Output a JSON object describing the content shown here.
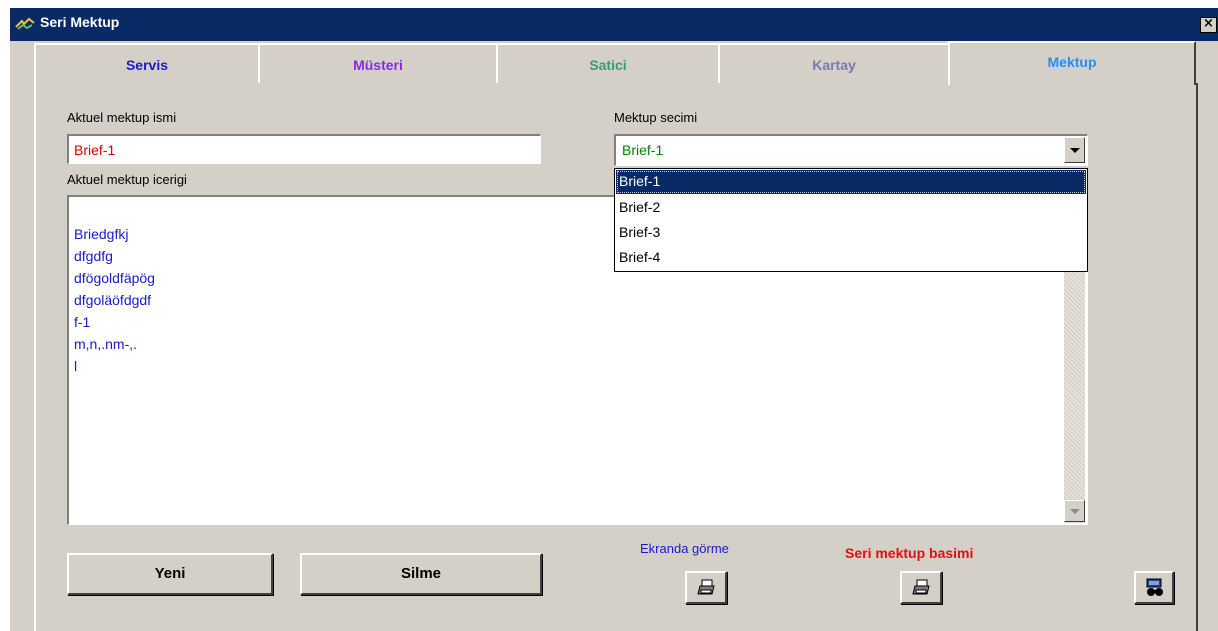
{
  "window": {
    "title": "Seri Mektup",
    "close_label": "×"
  },
  "tabs": [
    {
      "label": "Servis",
      "color": "#1a1acc"
    },
    {
      "label": "Müsteri",
      "color": "#8a2be2"
    },
    {
      "label": "Satici",
      "color": "#3c9a6a"
    },
    {
      "label": "Kartay",
      "color": "#7a7ab0"
    },
    {
      "label": "Mektup",
      "color": "#1e90ff",
      "active": true
    }
  ],
  "form": {
    "name_label": "Aktuel mektup ismi",
    "name_value": "Brief-1",
    "select_label": "Mektup secimi",
    "select_value": "Brief-1",
    "options": [
      "Brief-1",
      "Brief-2",
      "Brief-3",
      "Brief-4"
    ],
    "content_label": "Aktuel mektup icerigi",
    "content_lines": [
      "Briedgfkj",
      "dfgdfg",
      "dfögoldfäpög",
      "dfgoläöfdgdf",
      "f-1",
      "m,n,.nm-,.",
      "l"
    ]
  },
  "buttons": {
    "new_label": "Yeni",
    "delete_label": "Silme",
    "preview_label": "Ekranda  görme",
    "print_label": "Seri mektup basimi"
  },
  "colors": {
    "title_bg": "#0a2a66",
    "window_bg": "#d4d0c8",
    "name_text": "#d40000",
    "select_text": "#008000",
    "content_text": "#1a1acc",
    "preview_label": "#1a1acc",
    "print_label": "#e01010"
  }
}
